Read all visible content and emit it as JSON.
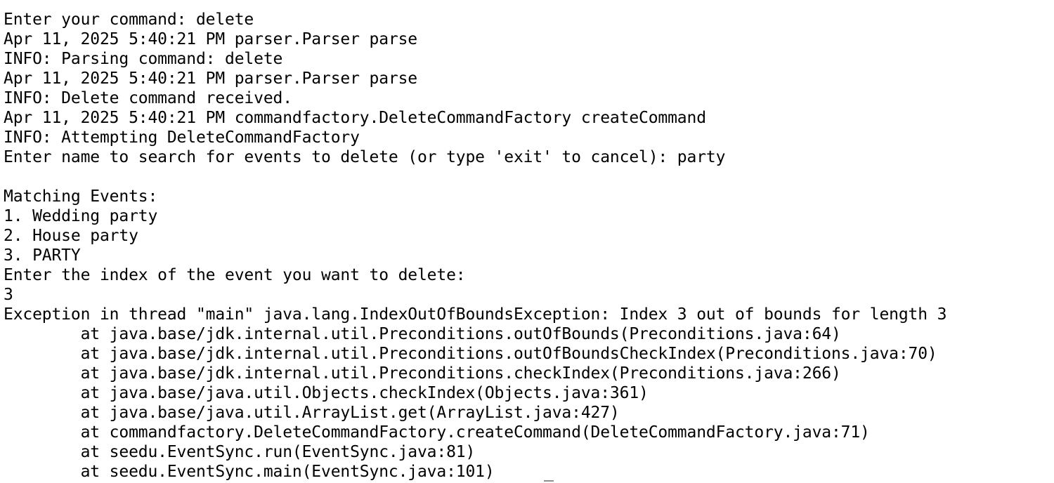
{
  "terminal": {
    "lines": [
      "Enter your command: delete",
      "Apr 11, 2025 5:40:21 PM parser.Parser parse",
      "INFO: Parsing command: delete",
      "Apr 11, 2025 5:40:21 PM parser.Parser parse",
      "INFO: Delete command received.",
      "Apr 11, 2025 5:40:21 PM commandfactory.DeleteCommandFactory createCommand",
      "INFO: Attempting DeleteCommandFactory",
      "Enter name to search for events to delete (or type 'exit' to cancel): party",
      "",
      "Matching Events:",
      "1. Wedding party",
      "2. House party",
      "3. PARTY",
      "Enter the index of the event you want to delete:",
      "3",
      "Exception in thread \"main\" java.lang.IndexOutOfBoundsException: Index 3 out of bounds for length 3",
      "\tat java.base/jdk.internal.util.Preconditions.outOfBounds(Preconditions.java:64)",
      "\tat java.base/jdk.internal.util.Preconditions.outOfBoundsCheckIndex(Preconditions.java:70)",
      "\tat java.base/jdk.internal.util.Preconditions.checkIndex(Preconditions.java:266)",
      "\tat java.base/java.util.Objects.checkIndex(Objects.java:361)",
      "\tat java.base/java.util.ArrayList.get(ArrayList.java:427)",
      "\tat commandfactory.DeleteCommandFactory.createCommand(DeleteCommandFactory.java:71)",
      "\tat seedu.EventSync.run(EventSync.java:81)",
      "\tat seedu.EventSync.main(EventSync.java:101)"
    ]
  }
}
